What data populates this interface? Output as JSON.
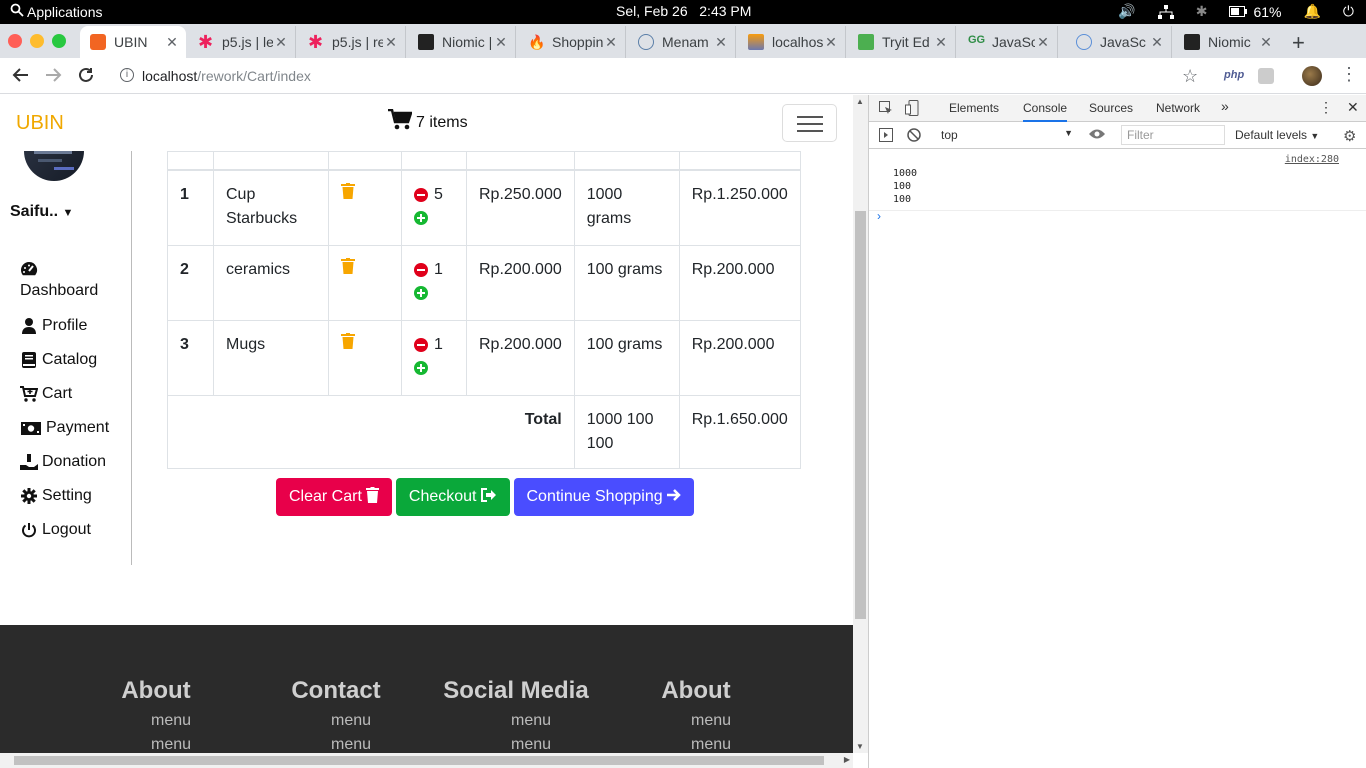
{
  "os": {
    "apps_label": "Applications",
    "clock": "Sel, Feb 26   2:43 PM",
    "battery": "61%"
  },
  "browser": {
    "tabs": [
      {
        "title": "UBIN",
        "active": true
      },
      {
        "title": "p5.js | le"
      },
      {
        "title": "p5.js | re"
      },
      {
        "title": "Niomic | "
      },
      {
        "title": "Shoppin"
      },
      {
        "title": "Menam"
      },
      {
        "title": "localhos"
      },
      {
        "title": "Tryit Ed"
      },
      {
        "title": "JavaSc"
      },
      {
        "title": "JavaSc"
      },
      {
        "title": "Niomic"
      }
    ],
    "url_host": "localhost",
    "url_path": "/rework/Cart/index",
    "ext_php": "php"
  },
  "navbar": {
    "brand": "UBIN",
    "cart_items": "7 items"
  },
  "sidebar": {
    "username": "Saifu..",
    "items": [
      {
        "label": "Dashboard",
        "icon": "dashboard-icon"
      },
      {
        "label": "Profile",
        "icon": "user-icon"
      },
      {
        "label": "Catalog",
        "icon": "book-icon"
      },
      {
        "label": "Cart",
        "icon": "cart-icon"
      },
      {
        "label": "Payment",
        "icon": "money-icon"
      },
      {
        "label": "Donation",
        "icon": "donation-icon"
      },
      {
        "label": "Setting",
        "icon": "gear-icon"
      },
      {
        "label": "Logout",
        "icon": "power-icon"
      }
    ]
  },
  "cart": {
    "rows": [
      {
        "no": "1",
        "name": "Cup Starbucks",
        "qty": "5",
        "price": "Rp.250.000",
        "weight": "1000 grams",
        "subtotal": "Rp.1.250.000"
      },
      {
        "no": "2",
        "name": "ceramics",
        "qty": "1",
        "price": "Rp.200.000",
        "weight": "100 grams",
        "subtotal": "Rp.200.000"
      },
      {
        "no": "3",
        "name": "Mugs",
        "qty": "1",
        "price": "Rp.200.000",
        "weight": "100 grams",
        "subtotal": "Rp.200.000"
      }
    ],
    "total_label": "Total",
    "total_weight": "1000 100 100",
    "total_price": "Rp.1.650.000"
  },
  "buttons": {
    "clear": "Clear Cart",
    "checkout": "Checkout",
    "continue": "Continue Shopping"
  },
  "footer": {
    "columns": [
      {
        "title": "About",
        "items": [
          "menu",
          "menu"
        ]
      },
      {
        "title": "Contact",
        "items": [
          "menu",
          "menu"
        ]
      },
      {
        "title": "Social Media",
        "items": [
          "menu",
          "menu"
        ]
      },
      {
        "title": "About",
        "items": [
          "menu",
          "menu"
        ]
      }
    ]
  },
  "devtools": {
    "tabs": [
      "Elements",
      "Console",
      "Sources",
      "Network"
    ],
    "active_tab": "Console",
    "context": "top",
    "filter_placeholder": "Filter",
    "levels": "Default levels",
    "log_source": "index:280",
    "log_lines": [
      "1000",
      "100",
      "100"
    ]
  },
  "colors": {
    "brand": "#f0a800",
    "clear_btn": "#e8004a",
    "checkout_btn": "#0aa83a",
    "continue_btn": "#4a4dff",
    "footer_bg": "#2b2b2b"
  }
}
